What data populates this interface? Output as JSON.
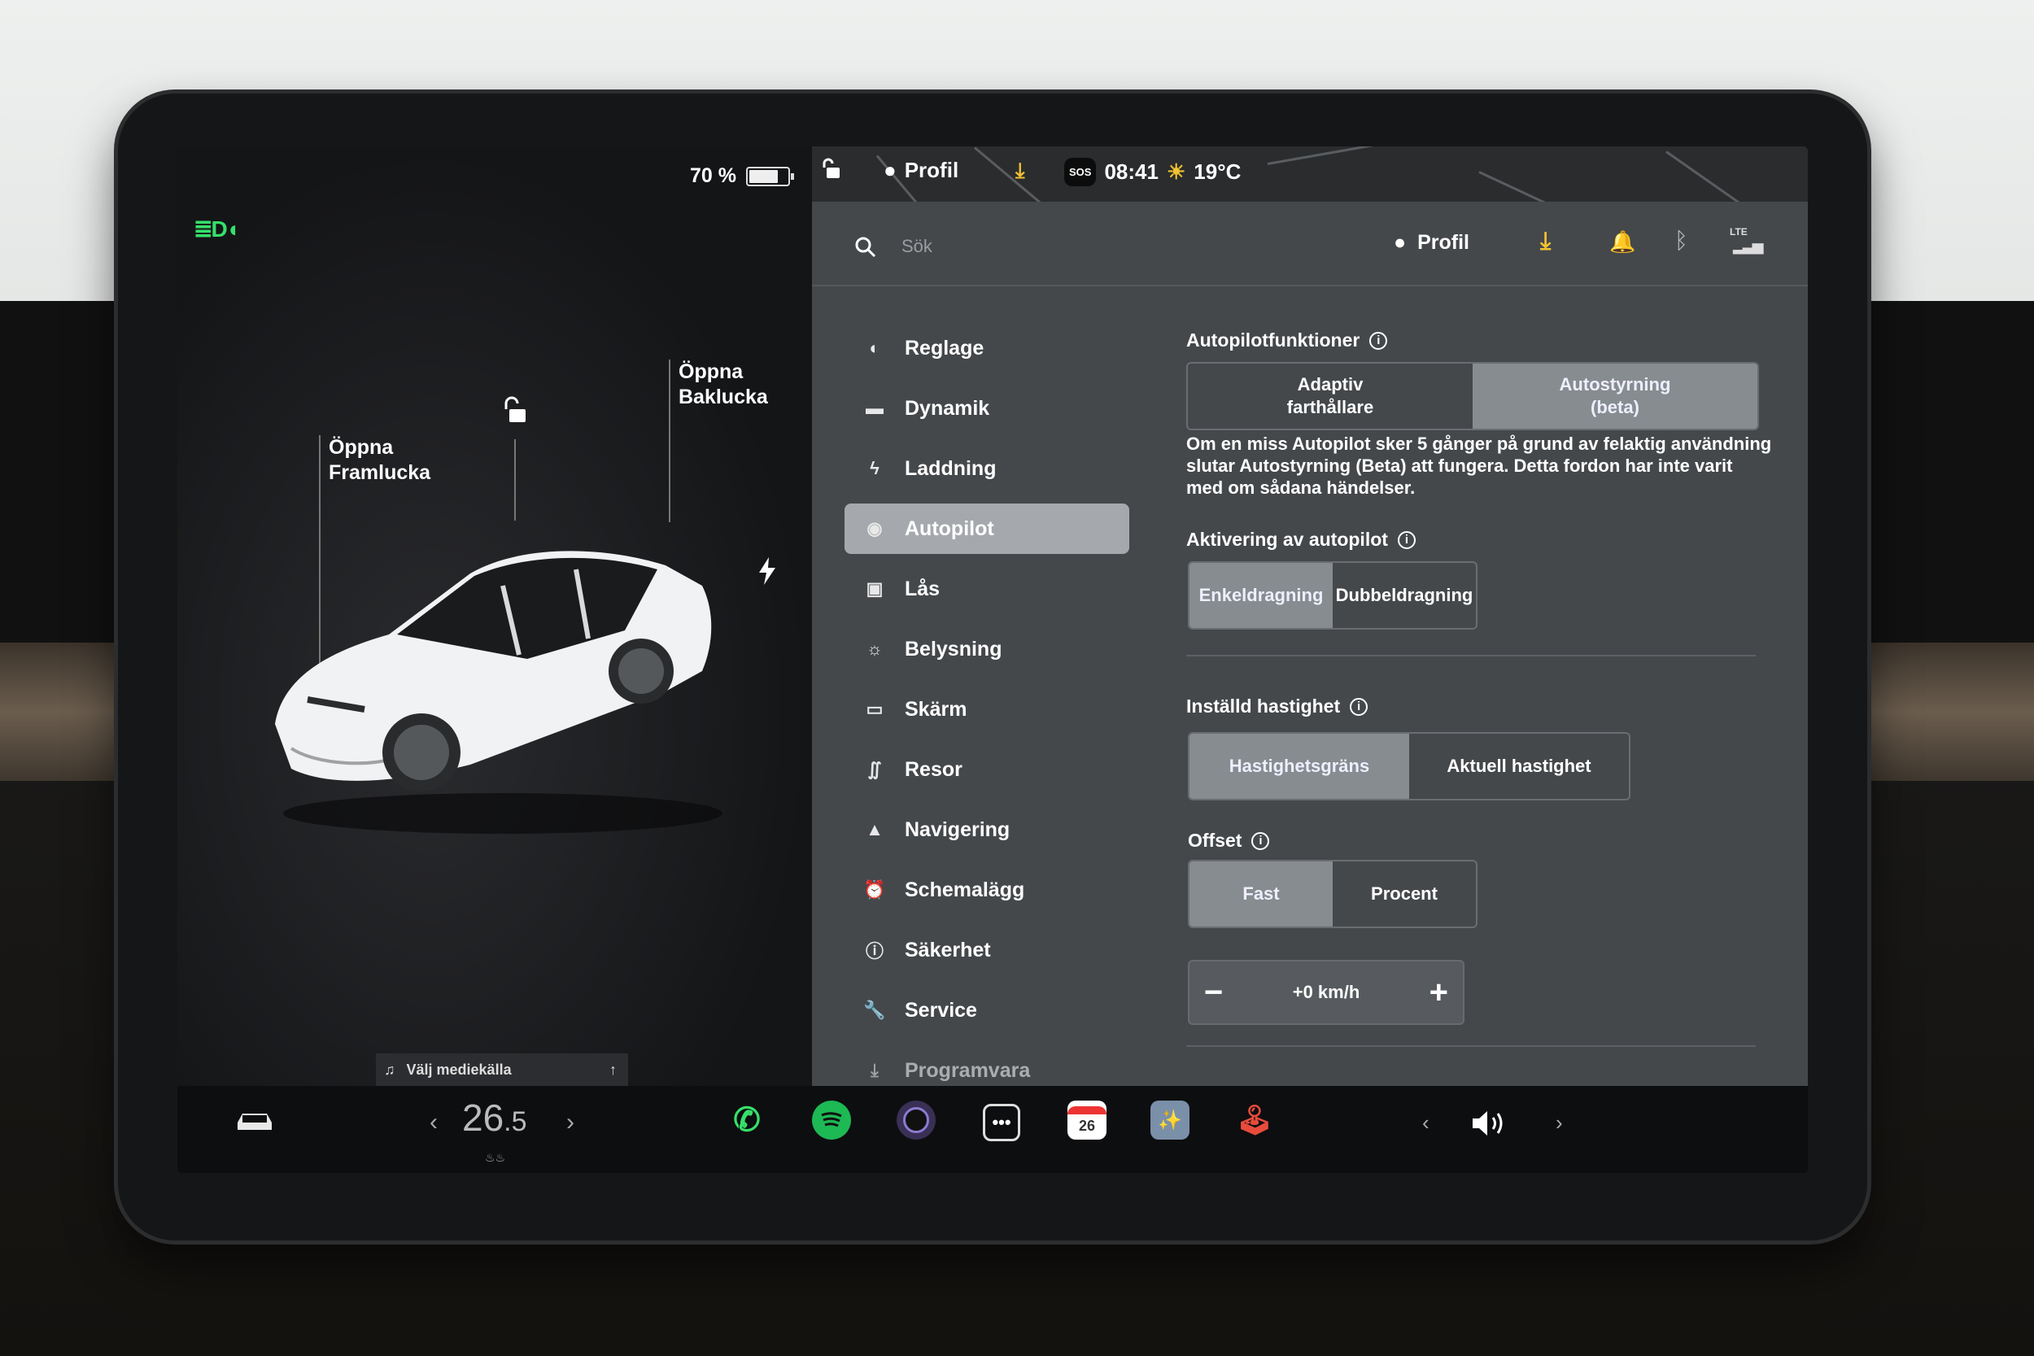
{
  "status": {
    "battery_percent": "70 %",
    "battery_level": 0.7,
    "profile": "Profil",
    "sos": "SOS",
    "time": "08:41",
    "temperature": "19°C"
  },
  "car_panel": {
    "front_trunk": "Öppna\nFramlucka",
    "rear_trunk": "Öppna\nBaklucka",
    "media_source": "Välj mediekälla"
  },
  "search": {
    "placeholder": "Sök"
  },
  "header": {
    "profile": "Profil",
    "network": "LTE"
  },
  "menu": [
    {
      "label": "Reglage",
      "icon": "toggle-icon"
    },
    {
      "label": "Dynamik",
      "icon": "car-icon"
    },
    {
      "label": "Laddning",
      "icon": "bolt-icon"
    },
    {
      "label": "Autopilot",
      "icon": "steering-wheel-icon",
      "active": true
    },
    {
      "label": "Lås",
      "icon": "lock-icon"
    },
    {
      "label": "Belysning",
      "icon": "sun-icon"
    },
    {
      "label": "Skärm",
      "icon": "display-icon"
    },
    {
      "label": "Resor",
      "icon": "trips-icon"
    },
    {
      "label": "Navigering",
      "icon": "navigation-icon"
    },
    {
      "label": "Schemalägg",
      "icon": "alarm-clock-icon"
    },
    {
      "label": "Säkerhet",
      "icon": "alert-icon"
    },
    {
      "label": "Service",
      "icon": "wrench-icon"
    },
    {
      "label": "Programvara",
      "icon": "download-icon"
    }
  ],
  "autopilot": {
    "features_title": "Autopilotfunktioner",
    "features_options": [
      "Adaptiv\nfarthållare",
      "Autostyrning\n(beta)"
    ],
    "features_selected": "Autostyrning\n(beta)",
    "warning": "Om en miss Autopilot sker 5 gånger på grund av felaktig användning slutar Autostyrning (Beta) att fungera. Detta fordon har inte varit med om sådana händelser.",
    "activation_title": "Aktivering av autopilot",
    "activation_options": [
      "Enkeldragning",
      "Dubbeldragning"
    ],
    "activation_selected": "Enkeldragning",
    "speed_title": "Inställd hastighet",
    "speed_options": [
      "Hastighetsgräns",
      "Aktuell hastighet"
    ],
    "speed_selected": "Hastighetsgräns",
    "offset_title": "Offset",
    "offset_options": [
      "Fast",
      "Procent"
    ],
    "offset_selected": "Fast",
    "offset_value": "+0 km/h",
    "minus": "−",
    "plus": "+"
  },
  "bottom": {
    "cabin_temp_int": "26",
    "cabin_temp_dec": ".5",
    "calendar_day": "26",
    "left_arrow": "‹",
    "right_arrow": "›"
  },
  "colors": {
    "accent_green": "#36e06a",
    "spotify": "#1db954",
    "download": "#f2c230"
  }
}
